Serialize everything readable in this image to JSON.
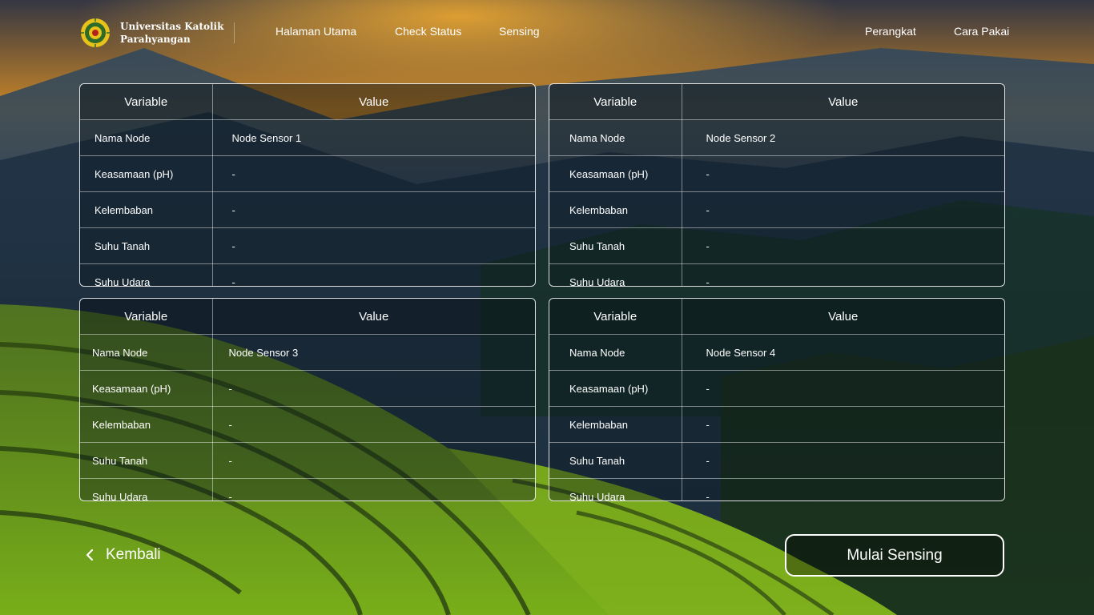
{
  "brand": {
    "line1": "Universitas Katolik",
    "line2": "Parahyangan"
  },
  "nav": {
    "left": [
      "Halaman Utama",
      "Check Status",
      "Sensing"
    ],
    "right": [
      "Perangkat",
      "Cara Pakai"
    ]
  },
  "table_headers": {
    "variable": "Variable",
    "value": "Value"
  },
  "nodes": [
    {
      "rows": [
        {
          "variable": "Nama Node",
          "value": "Node Sensor 1"
        },
        {
          "variable": "Keasamaan (pH)",
          "value": "-"
        },
        {
          "variable": "Kelembaban",
          "value": "-"
        },
        {
          "variable": "Suhu Tanah",
          "value": "-"
        },
        {
          "variable": "Suhu Udara",
          "value": "-"
        }
      ]
    },
    {
      "rows": [
        {
          "variable": "Nama Node",
          "value": "Node Sensor 2"
        },
        {
          "variable": "Keasamaan (pH)",
          "value": "-"
        },
        {
          "variable": "Kelembaban",
          "value": "-"
        },
        {
          "variable": "Suhu Tanah",
          "value": "-"
        },
        {
          "variable": "Suhu Udara",
          "value": "-"
        }
      ]
    },
    {
      "rows": [
        {
          "variable": "Nama Node",
          "value": "Node Sensor 3"
        },
        {
          "variable": "Keasamaan (pH)",
          "value": "-"
        },
        {
          "variable": "Kelembaban",
          "value": "-"
        },
        {
          "variable": "Suhu Tanah",
          "value": "-"
        },
        {
          "variable": "Suhu Udara",
          "value": "-"
        }
      ]
    },
    {
      "rows": [
        {
          "variable": "Nama Node",
          "value": "Node Sensor 4"
        },
        {
          "variable": "Keasamaan (pH)",
          "value": "-"
        },
        {
          "variable": "Kelembaban",
          "value": "-"
        },
        {
          "variable": "Suhu Tanah",
          "value": "-"
        },
        {
          "variable": "Suhu Udara",
          "value": "-"
        }
      ]
    }
  ],
  "actions": {
    "back_label": "Kembali",
    "start_label": "Mulai Sensing"
  },
  "colors": {
    "accent": "#ffffff",
    "sky_sunset": "#f2a02a",
    "terrace_green": "#7dbb1e"
  },
  "icons": {
    "logo": "university-seal-icon",
    "back": "chevron-left-icon"
  }
}
